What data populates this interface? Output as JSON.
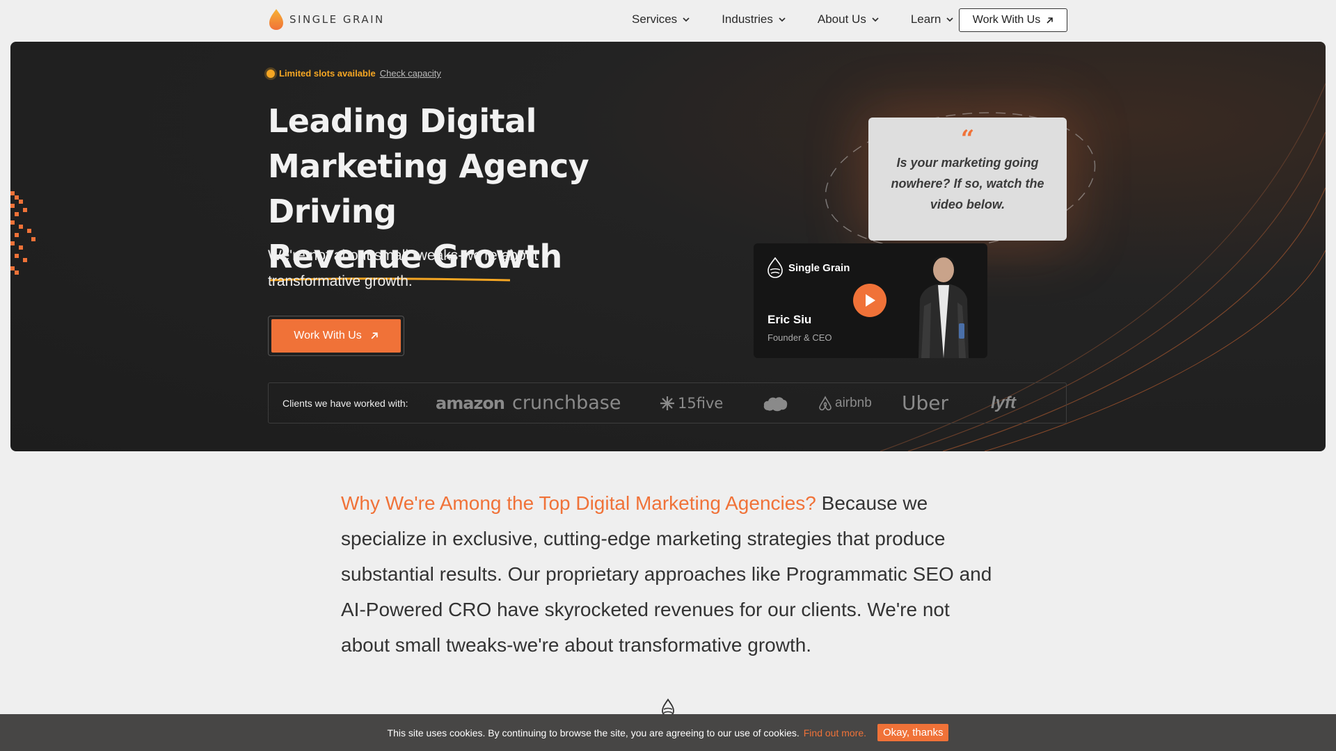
{
  "brand": {
    "name": "SINGLE GRAIN",
    "accent": "#f07238",
    "badge_color": "#f5a623"
  },
  "nav": {
    "items": [
      {
        "label": "Services"
      },
      {
        "label": "Industries"
      },
      {
        "label": "About Us"
      },
      {
        "label": "Learn"
      }
    ],
    "cta": "Work With Us"
  },
  "hero": {
    "badge_strong": "Limited slots available",
    "badge_link": "Check capacity",
    "headline_line1": "Leading Digital",
    "headline_line2": "Marketing Agency",
    "headline_line3_prefix": "Driving ",
    "headline_highlight": "Revenue Growth",
    "subhead": "We're not about small tweaks-we're about transformative growth.",
    "cta": "Work With Us",
    "quote_mark": "“",
    "quote": "Is your marketing going nowhere? If so, watch the video below.",
    "video": {
      "brand": "Single Grain",
      "name": "Eric Siu",
      "role": "Founder & CEO"
    },
    "clients_label": "Clients we have worked with:",
    "clients": [
      "amazon",
      "crunchbase",
      "15five",
      "salesforce",
      "airbnb",
      "Uber",
      "lyft"
    ]
  },
  "why": {
    "accent": "Why We're Among the Top Digital Marketing Agencies?",
    "body": " Because we specialize in exclusive, cutting-edge marketing strategies that produce substantial results. Our proprietary approaches like Programmatic SEO and AI-Powered CRO have skyrocketed revenues for our clients. We're not about small tweaks-we're about transformative growth."
  },
  "cookie": {
    "text": "This site uses cookies. By continuing to browse the site, you are agreeing to our use of cookies.",
    "link": "Find out more.",
    "button": "Okay, thanks"
  }
}
